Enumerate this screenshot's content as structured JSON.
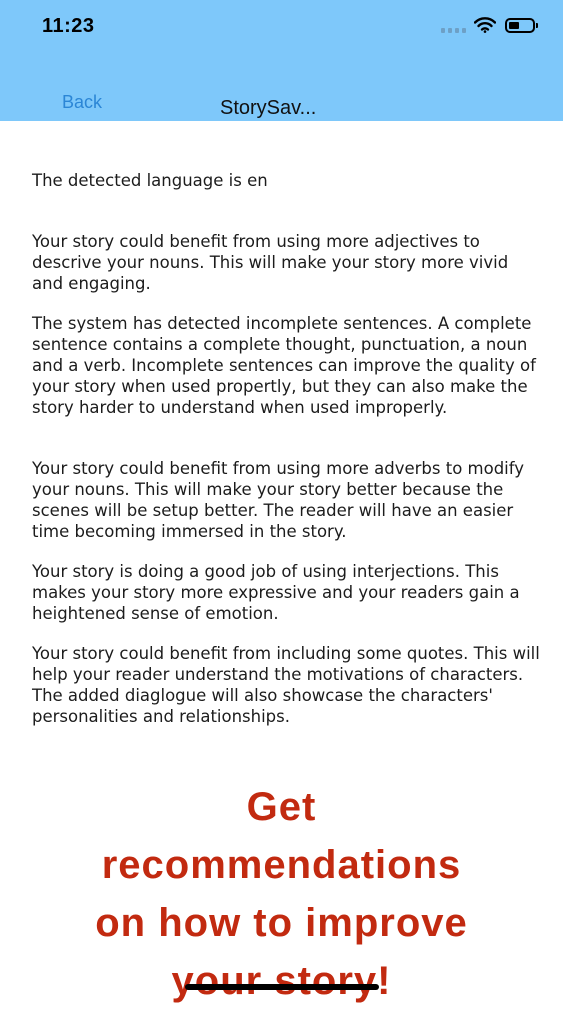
{
  "status_bar": {
    "time": "11:23"
  },
  "nav": {
    "back_label": "Back",
    "title": "StorySav..."
  },
  "content": {
    "language_line": "The detected language is en",
    "paragraphs": [
      "Your story could benefit from using more adjectives to descrive your nouns. This will make your story more vivid and engaging.",
      "The system has detected incomplete sentences. A complete sentence contains a complete thought, punctuation, a noun and a verb. Incomplete sentences can improve the quality of your story when used propertly, but they can also make the story harder to understand when used improperly.",
      "Your story could benefit from using more adverbs to modify your nouns. This will make your story better because the scenes will be setup better. The reader will have an easier time becoming immersed in the story.",
      "Your story is doing a good job of using interjections. This makes your story more expressive and your readers gain a heightened sense of emotion.",
      "Your story could benefit from including some quotes. This will help your reader understand the motivations of characters. The added diaglogue will also showcase the characters' personalities and relationships."
    ]
  },
  "promo": {
    "lines": [
      "Get",
      "recommendations",
      "on how to improve",
      "your story!"
    ]
  },
  "colors": {
    "header_bg": "#7ec8fa",
    "back_link": "#2b86d6",
    "promo_text": "#c22a10"
  }
}
